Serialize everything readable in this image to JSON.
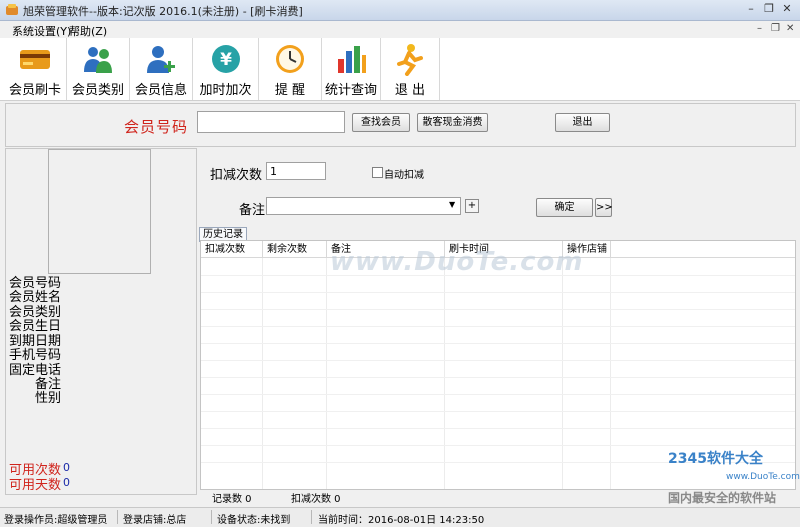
{
  "window": {
    "title": "旭荣管理软件--版本:记次版 2016.1(未注册) - [刷卡消费]",
    "minimize_glyph": "–",
    "restore_glyph": "❐",
    "close_glyph": "✕"
  },
  "menu": {
    "items": [
      {
        "label": "系统设置(Y)"
      },
      {
        "label": "帮助(Z)"
      }
    ]
  },
  "toolbar": {
    "items": [
      {
        "label": "会员刷卡",
        "icon": "card-icon"
      },
      {
        "label": "会员类别",
        "icon": "users-icon"
      },
      {
        "label": "会员信息",
        "icon": "user-add-icon"
      },
      {
        "label": "加时加次",
        "icon": "yen-icon"
      },
      {
        "label": "提  醒",
        "icon": "clock-icon"
      },
      {
        "label": "统计查询",
        "icon": "chart-icon"
      },
      {
        "label": "退  出",
        "icon": "exit-runner-icon"
      }
    ]
  },
  "search": {
    "label": "会员号码",
    "value": "",
    "find_button": "查找会员",
    "cash_button": "散客现金消费",
    "exit_button": "退出"
  },
  "member_info": {
    "fields": [
      "会员号码",
      "会员姓名",
      "会员类别",
      "会员生日",
      "到期日期",
      "手机号码",
      "固定电话",
      "备注",
      "性别"
    ],
    "available_times_label": "可用次数",
    "available_times_value": "0",
    "available_days_label": "可用天数",
    "available_days_value": "0"
  },
  "deduct": {
    "label": "扣减次数",
    "value": "1",
    "auto_label": "自动扣减",
    "auto_checked": false,
    "remark_label": "备注",
    "remark_value": "",
    "add_glyph": "+",
    "confirm_button": "确定",
    "more_button": ">>"
  },
  "history": {
    "tab_label": "历史记录",
    "columns": [
      "扣减次数",
      "剩余次数",
      "备注",
      "刷卡时间",
      "操作店铺"
    ],
    "rows": [],
    "record_count_label": "记录数 0",
    "deduct_count_label": "扣减次数 0"
  },
  "status": {
    "operator": "登录操作员:超级管理员",
    "store": "登录店铺:总店",
    "device": "设备状态:未找到",
    "time": "当前时间：2016-08-01日 14:23:50"
  },
  "watermarks": {
    "duote": "www.DuoTe.com",
    "brand": "2345软件大全",
    "url": "www.DuoTe.com",
    "slogan": "国内最安全的软件站"
  },
  "colors": {
    "accent_red": "#d0241c",
    "value_blue": "#1c2aa8"
  }
}
